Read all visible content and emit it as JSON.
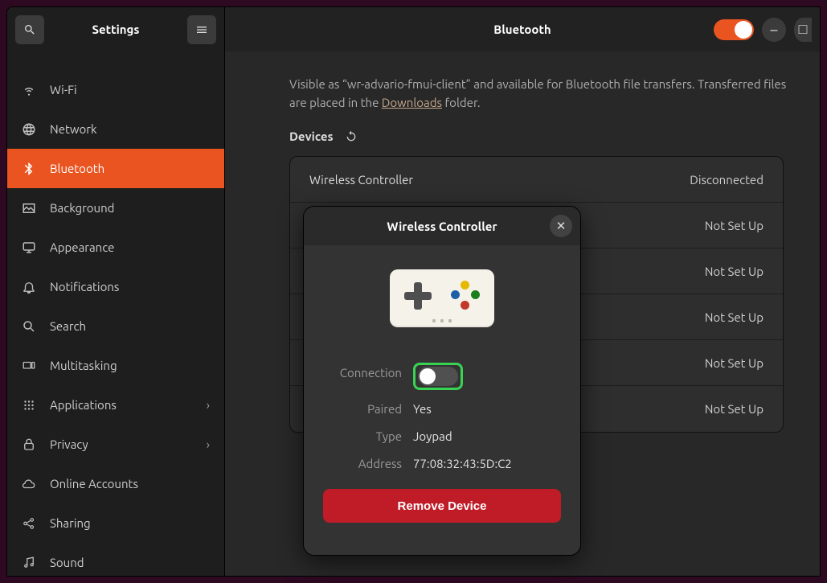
{
  "sidebar": {
    "title": "Settings",
    "items": [
      {
        "label": "Wi-Fi"
      },
      {
        "label": "Network"
      },
      {
        "label": "Bluetooth",
        "active": true
      },
      {
        "label": "Background"
      },
      {
        "label": "Appearance"
      },
      {
        "label": "Notifications"
      },
      {
        "label": "Search"
      },
      {
        "label": "Multitasking"
      },
      {
        "label": "Applications",
        "chevron": true
      },
      {
        "label": "Privacy",
        "chevron": true
      },
      {
        "label": "Online Accounts"
      },
      {
        "label": "Sharing"
      },
      {
        "label": "Sound"
      }
    ]
  },
  "header": {
    "title": "Bluetooth",
    "toggle_on": true
  },
  "info": {
    "pre": "Visible as “",
    "hostname": "wr-advario-fmui-client",
    "mid1": "” and available for Bluetooth file transfers. Transferred files are placed in the ",
    "downloads_link": "Downloads",
    "post": " folder."
  },
  "devices_header": "Devices",
  "devices": [
    {
      "name": "Wireless Controller",
      "status": "Disconnected"
    },
    {
      "name": "",
      "status": "Not Set Up"
    },
    {
      "name": "",
      "status": "Not Set Up"
    },
    {
      "name": "",
      "status": "Not Set Up"
    },
    {
      "name": "",
      "status": "Not Set Up"
    },
    {
      "name": "",
      "status": "Not Set Up"
    }
  ],
  "dialog": {
    "title": "Wireless Controller",
    "close": "✕",
    "connection_label": "Connection",
    "connection_on": false,
    "paired_label": "Paired",
    "paired_value": "Yes",
    "type_label": "Type",
    "type_value": "Joypad",
    "address_label": "Address",
    "address_value": "77:08:32:43:5D:C2",
    "remove_label": "Remove Device"
  },
  "highlight_color": "#39d353"
}
